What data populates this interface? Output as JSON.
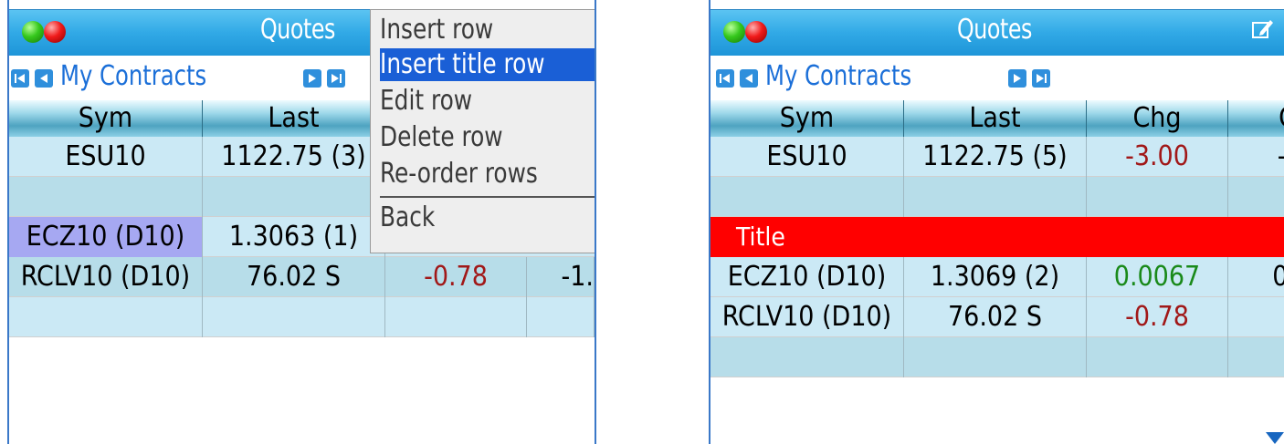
{
  "left": {
    "title": "Quotes",
    "nav_label": "My Contracts",
    "headers": [
      "Sym",
      "Last"
    ],
    "rows": [
      {
        "sym": "ESU10",
        "last": "1122.75 (3)",
        "chg": "",
        "col4": ""
      },
      {
        "sym": "",
        "last": "",
        "chg": "",
        "col4": ""
      },
      {
        "sym": "ECZ10 (D10)",
        "last": "1.3063 (1)",
        "chg": "",
        "col4": ""
      },
      {
        "sym": "RCLV10 (D10)",
        "last": "76.02 S",
        "chg": "-0.78",
        "col4": "-1."
      },
      {
        "sym": "",
        "last": "",
        "chg": "",
        "col4": ""
      }
    ],
    "menu": {
      "items": [
        "Insert row",
        "Insert title row",
        "Edit row",
        "Delete row",
        "Re-order rows",
        "Back"
      ],
      "active_index": 1
    }
  },
  "right": {
    "title": "Quotes",
    "nav_label": "My Contracts",
    "headers": [
      "Sym",
      "Last",
      "Chg",
      "C"
    ],
    "rows": [
      {
        "sym": "ESU10",
        "last": "1122.75 (5)",
        "chg": "-3.00",
        "col4": "-("
      },
      {
        "sym": "",
        "last": "",
        "chg": "",
        "col4": ""
      }
    ],
    "title_row": "Title",
    "rows_after": [
      {
        "sym": "ECZ10 (D10)",
        "last": "1.3069 (2)",
        "chg": "0.0067",
        "col4": "0."
      },
      {
        "sym": "RCLV10 (D10)",
        "last": "76.02 S",
        "chg": "-0.78",
        "col4": "-"
      },
      {
        "sym": "",
        "last": "",
        "chg": "",
        "col4": ""
      }
    ]
  },
  "colors": {
    "negative": "#a11818",
    "positive": "#1a8a1a",
    "title_row": "#ff0000",
    "menu_highlight": "#1a5fd6",
    "accent": "#31a9e6"
  }
}
